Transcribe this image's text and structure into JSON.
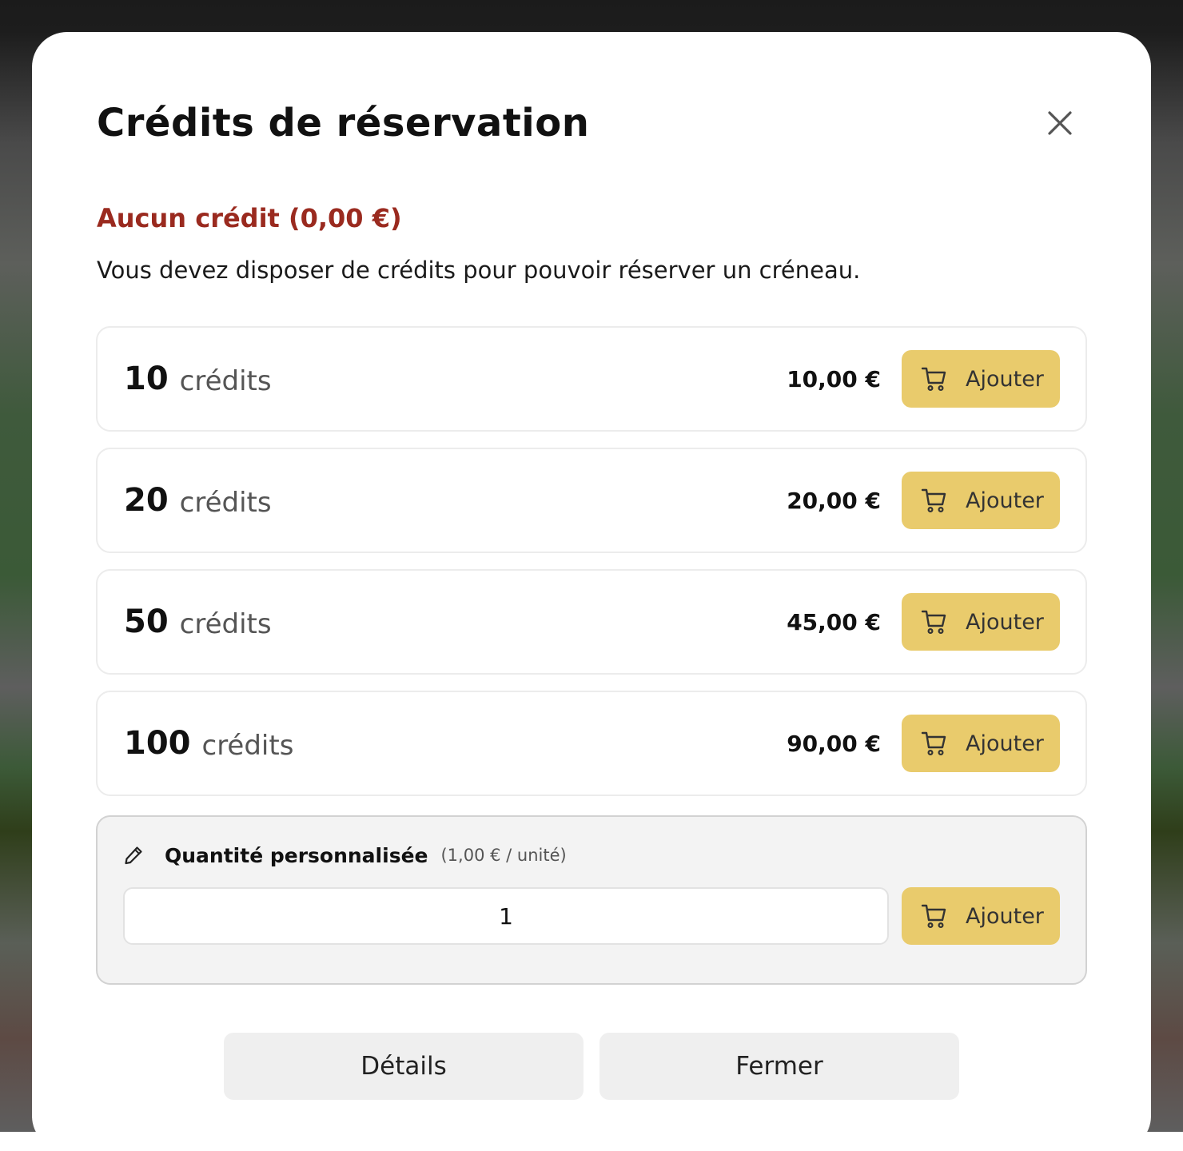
{
  "modal": {
    "title": "Crédits de réservation",
    "close_icon": "close-icon"
  },
  "balance": {
    "text": "Aucun crédit (0,00 €)",
    "color": "#9a2a1f"
  },
  "notice": "Vous devez disposer de crédits pour pouvoir réserver un créneau.",
  "packs": [
    {
      "quantity": "10",
      "unit": "crédits",
      "price": "10,00 €",
      "button_label": "Ajouter",
      "button_icon": "cart-icon"
    },
    {
      "quantity": "20",
      "unit": "crédits",
      "price": "20,00 €",
      "button_label": "Ajouter",
      "button_icon": "cart-icon"
    },
    {
      "quantity": "50",
      "unit": "crédits",
      "price": "45,00 €",
      "button_label": "Ajouter",
      "button_icon": "cart-icon"
    },
    {
      "quantity": "100",
      "unit": "crédits",
      "price": "90,00 €",
      "button_label": "Ajouter",
      "button_icon": "cart-icon"
    }
  ],
  "custom": {
    "icon": "pencil-icon",
    "title": "Quantité personnalisée",
    "rate": "(1,00 € / unité)",
    "quantity_value": "1",
    "button_label": "Ajouter",
    "button_icon": "cart-icon"
  },
  "footer": {
    "details_label": "Détails",
    "close_label": "Fermer"
  },
  "colors": {
    "accent_button": "#e9cb6c",
    "alert_text": "#9a2a1f",
    "secondary_button": "#efefef"
  }
}
